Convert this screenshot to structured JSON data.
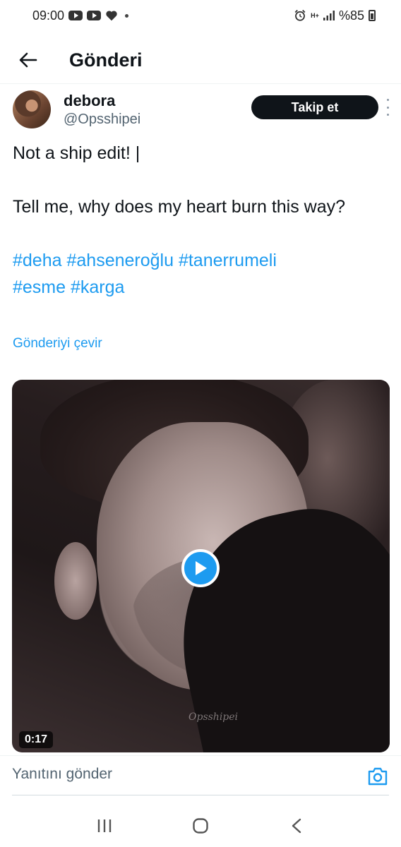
{
  "status_bar": {
    "time": "09:00",
    "network": "H+",
    "battery": "%85"
  },
  "header": {
    "title": "Gönderi"
  },
  "author": {
    "name": "debora",
    "handle": "@Opsshipei",
    "follow_label": "Takip et"
  },
  "tweet": {
    "line1": "Not a ship edit! |",
    "line2": "",
    "line3": "Tell me, why does my heart burn this way?",
    "line4": "",
    "hashtags": [
      "#deha",
      "#ahseneroğlu",
      "#tanerrumeli",
      "#esme",
      "#karga"
    ],
    "translate_label": "Gönderiyi çevir"
  },
  "video": {
    "duration": "0:17",
    "watermark": "Opsshipei"
  },
  "reply": {
    "placeholder": "Yanıtını gönder"
  },
  "colors": {
    "accent": "#1d9bf0",
    "text_primary": "#0f1419",
    "text_secondary": "#536471",
    "follow_bg": "#0f1419"
  },
  "icons": {
    "back": "arrow-left-icon",
    "more": "more-vertical-icon",
    "play": "play-icon",
    "camera": "camera-icon",
    "nav_recents": "recents-icon",
    "nav_home": "home-icon",
    "nav_back": "back-icon"
  }
}
